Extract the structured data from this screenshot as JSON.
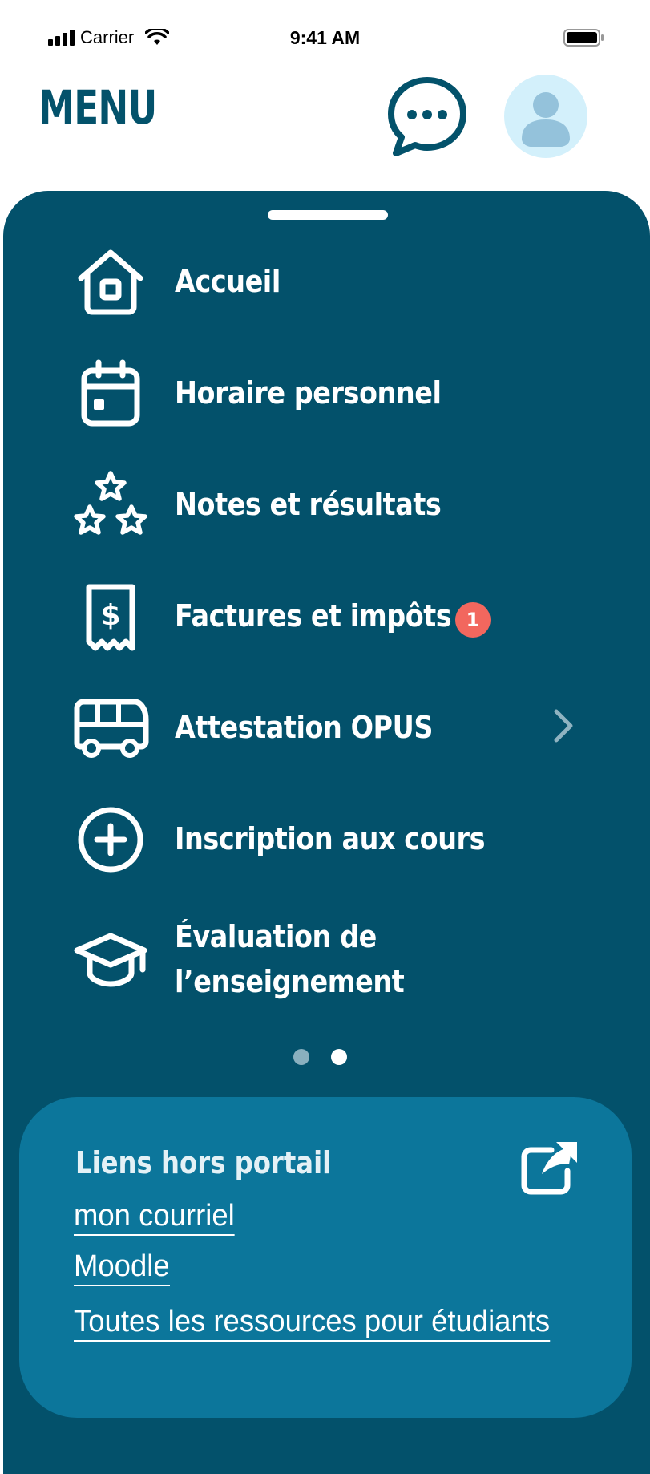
{
  "status_bar": {
    "carrier": "Carrier",
    "time": "9:41 AM"
  },
  "header": {
    "title": "MENU",
    "chat_icon": "chat-bubble-icon",
    "avatar_icon": "user-avatar-icon"
  },
  "menu": {
    "items": [
      {
        "label": "Accueil",
        "icon": "home-icon"
      },
      {
        "label": "Horaire personnel",
        "icon": "calendar-icon"
      },
      {
        "label": "Notes et résultats",
        "icon": "stars-icon"
      },
      {
        "label": "Factures et impôts",
        "icon": "receipt-dollar-icon",
        "badge": "1"
      },
      {
        "label": "Attestation OPUS",
        "icon": "bus-icon",
        "has_chevron": true
      },
      {
        "label": "Inscription aux cours",
        "icon": "plus-circle-icon"
      },
      {
        "label": "Évaluation de l’enseignement",
        "icon": "graduation-cap-icon"
      }
    ]
  },
  "pagination": {
    "pages": 2,
    "active_page": 2
  },
  "links": {
    "title": "Liens hors portail",
    "items": [
      {
        "label": "mon courriel"
      },
      {
        "label": "Moodle"
      },
      {
        "label": "Toutes les ressources pour étudiants"
      }
    ]
  },
  "colors": {
    "brand_dark": "#03516b",
    "card": "#0c769b",
    "avatar_bg": "#d3f0fb",
    "badge": "#f2675e"
  }
}
